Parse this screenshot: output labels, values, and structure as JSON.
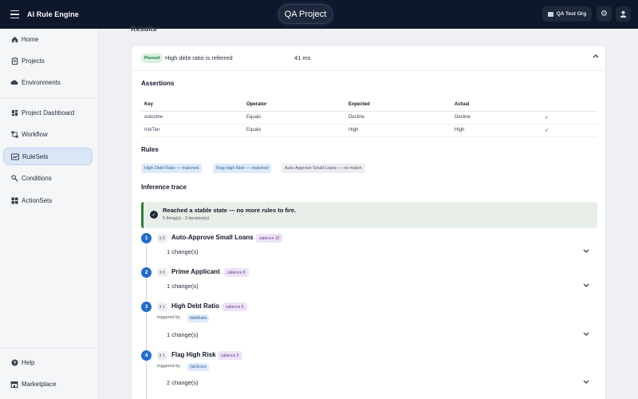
{
  "app": {
    "title": "AI Rule Engine",
    "project": "QA Project",
    "org": "QA Test Org"
  },
  "sidebar": {
    "items": [
      {
        "label": "Home",
        "icon": "home-icon"
      },
      {
        "label": "Projects",
        "icon": "clipboard-icon"
      },
      {
        "label": "Environments",
        "icon": "cloud-icon"
      },
      {
        "label": "Project Dashboard",
        "icon": "dashboard-icon"
      },
      {
        "label": "Workflow",
        "icon": "workflow-icon"
      },
      {
        "label": "RuleSets",
        "icon": "ruleset-icon",
        "active": true
      },
      {
        "label": "Conditions",
        "icon": "conditions-icon"
      },
      {
        "label": "ActionSets",
        "icon": "actionsets-icon"
      }
    ],
    "bottom": [
      {
        "label": "Help",
        "icon": "help-icon"
      },
      {
        "label": "Marketplace",
        "icon": "marketplace-icon"
      }
    ]
  },
  "main": {
    "results_title": "Results",
    "result": {
      "status": "Passed",
      "title": "High debt ratio is referred",
      "duration": "41 ms"
    },
    "assertions": {
      "title": "Assertions",
      "columns": [
        "Key",
        "Operator",
        "Expected",
        "Actual"
      ],
      "rows": [
        {
          "key": "outcome",
          "operator": "Equals",
          "expected": "Decline",
          "actual": "Decline",
          "check": "✓"
        },
        {
          "key": "riskTier",
          "operator": "Equals",
          "expected": "High",
          "actual": "High",
          "check": "✓"
        }
      ]
    },
    "rules": {
      "title": "Rules",
      "chips": [
        {
          "label": "High Debt Ratio — matched",
          "state": "matched"
        },
        {
          "label": "Flag High Risk — matched",
          "state": "matched"
        },
        {
          "label": "Auto-Approve Small Loans — no match",
          "state": "nomatch"
        }
      ]
    },
    "trace": {
      "title": "Inference trace",
      "stable_title": "Reached a stable state — no more rules to fire.",
      "stable_sub": "5 firing(s) · 3 iteration(s)",
      "steps": [
        {
          "num": "1",
          "iter": "it 0",
          "name": "Auto-Approve Small Loans",
          "salience": "salience 10",
          "changes": "1 change(s)"
        },
        {
          "num": "2",
          "iter": "it 0",
          "name": "Prime Applicant",
          "salience": "salience 8",
          "changes": "1 change(s)"
        },
        {
          "num": "3",
          "iter": "it 1",
          "name": "High Debt Ratio",
          "salience": "salience 5",
          "triggered_by_label": "triggered by",
          "triggered_by": "debtRatio",
          "changes": "1 change(s)"
        },
        {
          "num": "4",
          "iter": "it 1",
          "name": "Flag High Risk",
          "salience": "salience 5",
          "triggered_by_label": "triggered by",
          "triggered_by": "riskScore",
          "changes": "2 change(s)"
        }
      ]
    }
  }
}
